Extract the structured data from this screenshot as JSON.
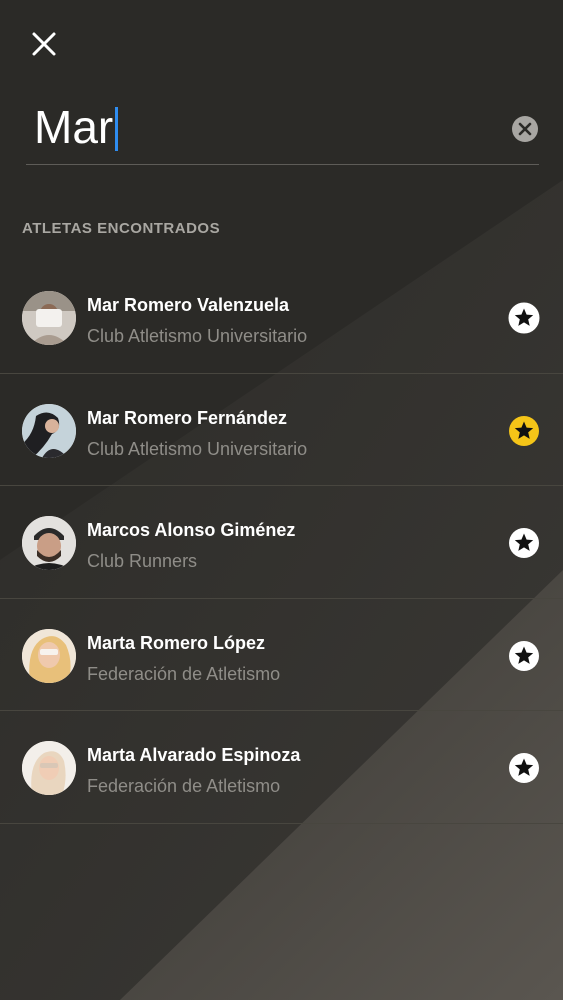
{
  "search": {
    "value": "Mar",
    "placeholder": ""
  },
  "section_label": "ATLETAS ENCONTRADOS",
  "results": [
    {
      "name": "Mar Romero Valenzuela",
      "club": "Club Atletismo Universitario",
      "favorite": false
    },
    {
      "name": "Mar Romero Fernández",
      "club": "Club Atletismo Universitario",
      "favorite": true
    },
    {
      "name": "Marcos Alonso Giménez",
      "club": "Club Runners",
      "favorite": false
    },
    {
      "name": "Marta Romero López",
      "club": "Federación de Atletismo",
      "favorite": false
    },
    {
      "name": "Marta Alvarado Espinoza",
      "club": "Federación de Atletismo",
      "favorite": false
    }
  ],
  "icons": {
    "close": "close-icon",
    "clear": "clear-circle-icon",
    "favorite": "star-icon"
  },
  "colors": {
    "background": "#2b2a27",
    "accent": "#f5c518",
    "caret": "#2f8df0"
  }
}
